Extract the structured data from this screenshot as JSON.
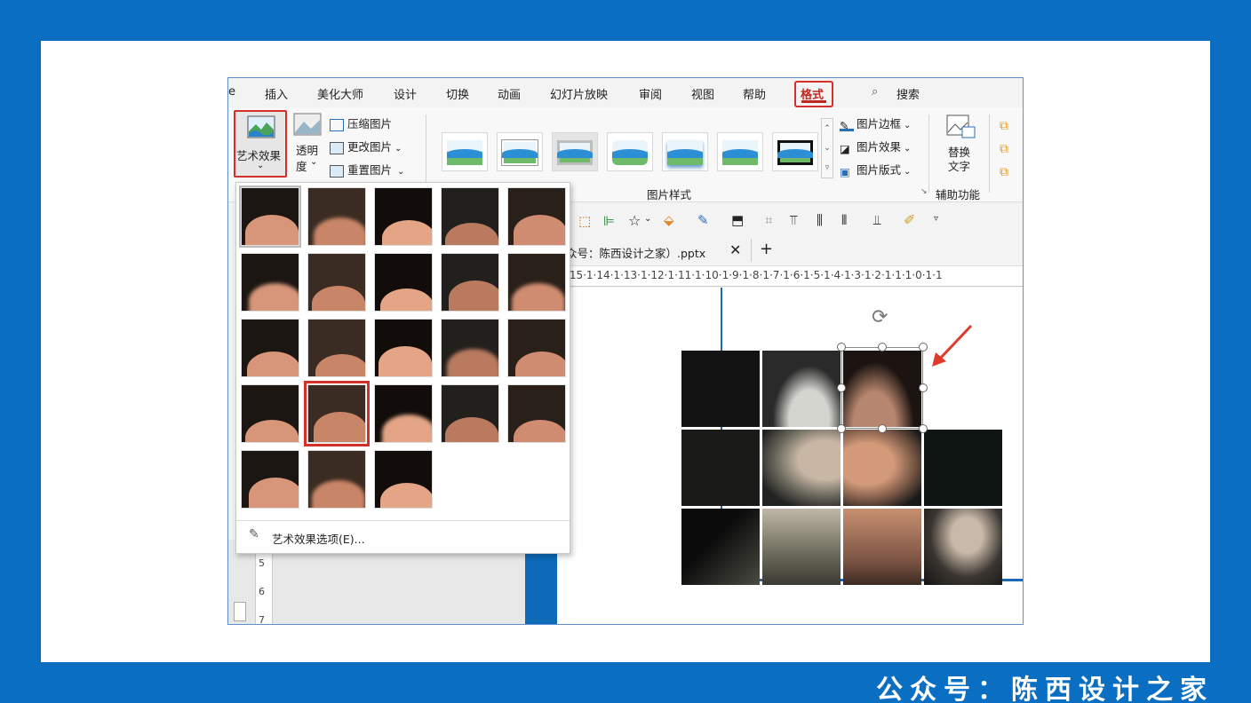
{
  "footer": "公众号：陈西设计之家",
  "menu": {
    "items": [
      "e",
      "插入",
      "美化大师",
      "设计",
      "切换",
      "动画",
      "幻灯片放映",
      "审阅",
      "视图",
      "帮助"
    ],
    "active": "格式",
    "search": "搜索"
  },
  "ribbon": {
    "art_effects": "艺术效果",
    "transparency_1": "透明",
    "transparency_2": "度",
    "compress": "压缩图片",
    "change": "更改图片",
    "reset": "重置图片",
    "border": "图片边框",
    "effects": "图片效果",
    "layout": "图片版式",
    "alt_text_1": "替换",
    "alt_text_2": "文字",
    "group_styles": "图片样式",
    "group_access": "辅助功能"
  },
  "document": {
    "tab_title": "众号：陈西设计之家）.pptx",
    "ruler": "·15·1·14·1·13·1·12·1·11·1·10·1·9·1·8·1·7·1·6·1·5·1·4·1·3·1·2·1·1·1·0·1·1",
    "vruler": [
      "5",
      "6",
      "7"
    ]
  },
  "dropdown": {
    "options_label": "艺术效果选项(E)...",
    "rows": 5,
    "cols": 5,
    "item_count": 23,
    "selected_index": 16
  },
  "colors": {
    "background": "#0a6fc2",
    "highlight": "#d4302a",
    "skin": "#d8957a"
  }
}
